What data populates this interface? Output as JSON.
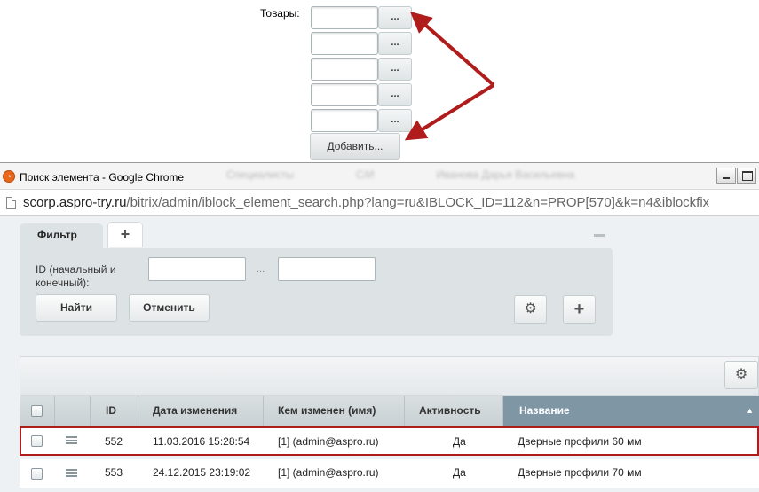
{
  "goods": {
    "label": "Товары:",
    "picker_label": "...",
    "rows": [
      "",
      "",
      "",
      "",
      ""
    ],
    "add_button": "Добавить..."
  },
  "window": {
    "title": "Поиск элемента - Google Chrome",
    "url_host": "scorp.aspro-try.ru",
    "url_path": "/bitrix/admin/iblock_element_search.php?lang=ru&IBLOCK_ID=112&n=PROP[570]&k=n4&iblockfix"
  },
  "filter": {
    "tab_label": "Фильтр",
    "add_tab": "+",
    "id_label": "ID (начальный и конечный):",
    "range_separator": "...",
    "find_button": "Найти",
    "cancel_button": "Отменить"
  },
  "grid": {
    "columns": [
      "ID",
      "Дата изменения",
      "Кем изменен (имя)",
      "Активность",
      "Название"
    ],
    "sorted_column": "Название",
    "rows": [
      {
        "id": "552",
        "date": "11.03.2016 15:28:54",
        "by": "[1] (admin@aspro.ru)",
        "active": "Да",
        "name": "Дверные профили 60 мм",
        "selected": true
      },
      {
        "id": "553",
        "date": "24.12.2015 23:19:02",
        "by": "[1] (admin@aspro.ru)",
        "active": "Да",
        "name": "Дверные профили 70 мм",
        "selected": false
      }
    ]
  },
  "colors": {
    "annotation_arrow": "#b01c1c",
    "sorted_header": "#7f97a5",
    "filter_panel": "#dde3e5"
  },
  "icons": [
    "chrome-logo-icon",
    "page-icon",
    "gear-icon",
    "plus-icon",
    "menu-icon",
    "sort-up-icon"
  ]
}
